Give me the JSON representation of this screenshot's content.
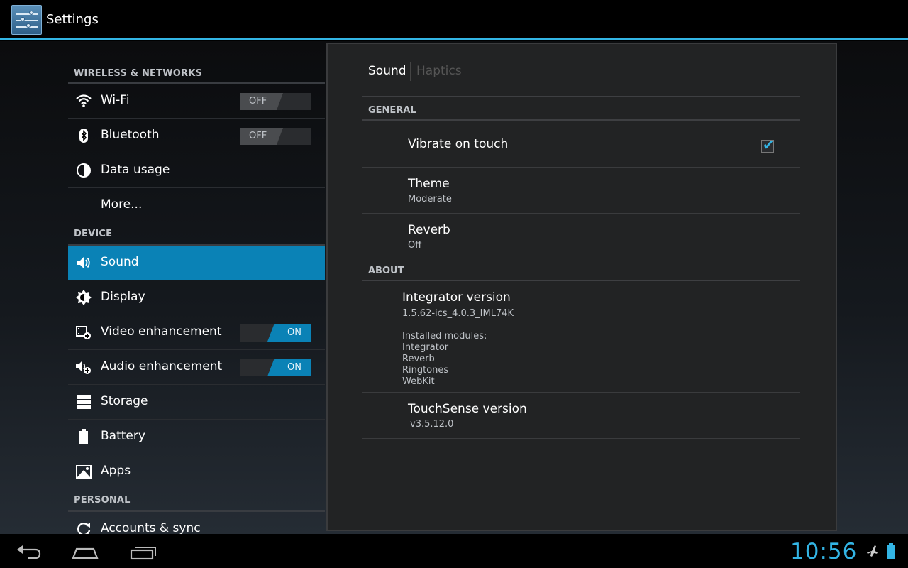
{
  "app": {
    "title": "Settings"
  },
  "left": {
    "sections": [
      {
        "header": "WIRELESS & NETWORKS"
      },
      {
        "header": "DEVICE"
      },
      {
        "header": "PERSONAL"
      }
    ],
    "items": {
      "wifi": {
        "label": "Wi-Fi",
        "icon": "wifi-icon",
        "toggle": "OFF"
      },
      "bluetooth": {
        "label": "Bluetooth",
        "icon": "bluetooth-icon",
        "toggle": "OFF"
      },
      "data_usage": {
        "label": "Data usage",
        "icon": "data-usage-icon"
      },
      "more": {
        "label": "More..."
      },
      "sound": {
        "label": "Sound",
        "icon": "speaker-icon"
      },
      "display": {
        "label": "Display",
        "icon": "brightness-icon"
      },
      "video": {
        "label": "Video enhancement",
        "icon": "video-enhance-icon",
        "toggle": "ON"
      },
      "audio": {
        "label": "Audio enhancement",
        "icon": "audio-enhance-icon",
        "toggle": "ON"
      },
      "storage": {
        "label": "Storage",
        "icon": "storage-icon"
      },
      "battery": {
        "label": "Battery",
        "icon": "battery-icon"
      },
      "apps": {
        "label": "Apps",
        "icon": "apps-icon"
      },
      "accounts": {
        "label": "Accounts & sync",
        "icon": "sync-icon"
      }
    }
  },
  "right": {
    "tabs": {
      "active": "Sound",
      "inactive": "Haptics"
    },
    "general_header": "GENERAL",
    "vibrate": {
      "title": "Vibrate on touch",
      "checked": true
    },
    "theme": {
      "title": "Theme",
      "value": "Moderate"
    },
    "reverb": {
      "title": "Reverb",
      "value": "Off"
    },
    "about_header": "ABOUT",
    "integrator": {
      "title": "Integrator version",
      "version": "1.5.62-ics_4.0.3_IML74K",
      "modules_label": "Installed modules:",
      "modules": [
        "Integrator",
        "Reverb",
        "Ringtones",
        "WebKit"
      ]
    },
    "touchsense": {
      "title": "TouchSense version",
      "version": "v3.5.12.0"
    }
  },
  "statusbar": {
    "time": "10:56"
  },
  "colors": {
    "accent": "#33b5e5",
    "selected": "#0a82b6"
  }
}
